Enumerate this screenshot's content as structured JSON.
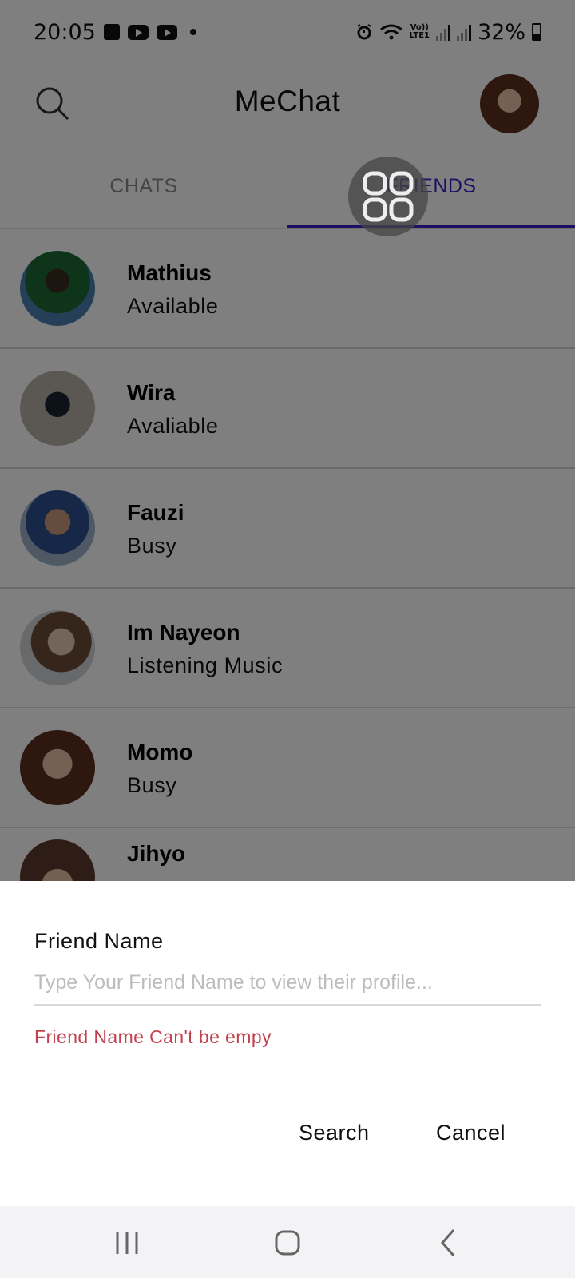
{
  "status_bar": {
    "time": "20:05",
    "volte_label": "Vo))\nLTE1",
    "battery": "32%"
  },
  "app_bar": {
    "title": "MeChat",
    "search_icon": "search-icon",
    "profile_avatar": "profile-avatar"
  },
  "tabs": [
    {
      "label": "CHATS",
      "active": false
    },
    {
      "label": "FRIENDS",
      "active": true
    }
  ],
  "friends": [
    {
      "name": "Mathius",
      "status": "Available"
    },
    {
      "name": "Wira",
      "status": "Avaliable"
    },
    {
      "name": "Fauzi",
      "status": "Busy"
    },
    {
      "name": "Im Nayeon",
      "status": "Listening Music"
    },
    {
      "name": "Momo",
      "status": "Busy"
    },
    {
      "name": "Jihyo",
      "status": ""
    }
  ],
  "dialog": {
    "label": "Friend Name",
    "input_value": "",
    "input_placeholder": "Type Your Friend Name to view their profile...",
    "error": "Friend Name Can't be empy",
    "search_label": "Search",
    "cancel_label": "Cancel"
  },
  "colors": {
    "accent": "#3d1ecb",
    "error": "#c2414f",
    "scrim": "rgba(0,0,0,0.5)"
  }
}
